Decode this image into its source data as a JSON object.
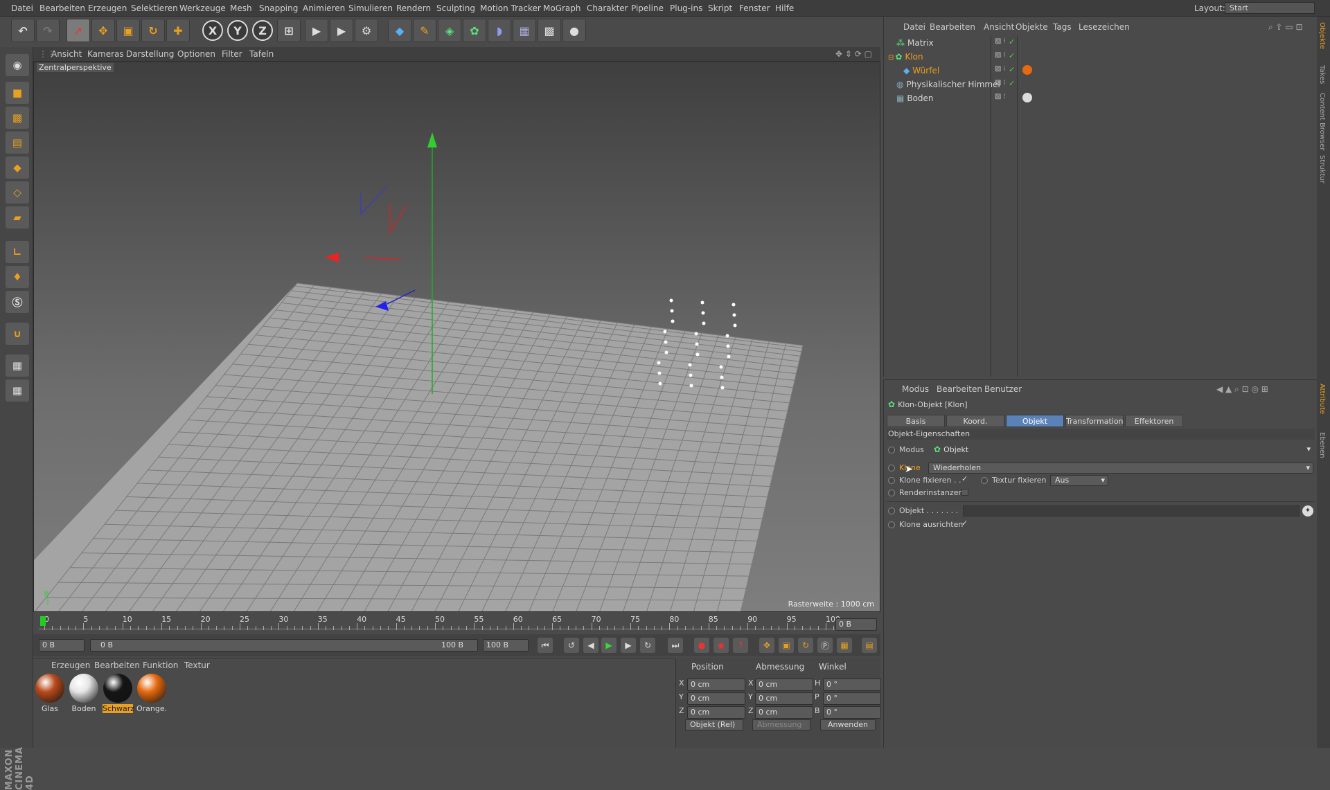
{
  "menubar": {
    "items": [
      "Datei",
      "Bearbeiten",
      "Erzeugen",
      "Selektieren",
      "Werkzeuge",
      "Mesh",
      "Snapping",
      "Animieren",
      "Simulieren",
      "Rendern",
      "Sculpting",
      "Motion Tracker",
      "MoGraph",
      "Charakter",
      "Pipeline",
      "Plug-ins",
      "Skript",
      "Fenster",
      "Hilfe"
    ],
    "layout_label": "Layout:",
    "layout_value": "Start"
  },
  "toolbar": {
    "axis_x": "X",
    "axis_y": "Y",
    "axis_z": "Z"
  },
  "viewport": {
    "menu": [
      "Ansicht",
      "Kameras",
      "Darstellung",
      "Optionen",
      "Filter",
      "Tafeln"
    ],
    "camera_label": "Zentralperspektive",
    "grid_size": "Rasterweite : 1000 cm"
  },
  "timeline": {
    "ticks": [
      "0",
      "5",
      "10",
      "15",
      "20",
      "25",
      "30",
      "35",
      "40",
      "45",
      "50",
      "55",
      "60",
      "65",
      "70",
      "75",
      "80",
      "85",
      "90",
      "95",
      "100"
    ],
    "current_frame": "0 B",
    "start_field": "0 B",
    "range_start": "0 B",
    "range_end": "100 B",
    "end_field": "100 B"
  },
  "materials": {
    "menu": [
      "Erzeugen",
      "Bearbeiten",
      "Funktion",
      "Textur"
    ],
    "items": [
      {
        "name": "Glas",
        "color": "#b84a1c"
      },
      {
        "name": "Boden",
        "color": "#e6e6e6"
      },
      {
        "name": "Schwarz",
        "color": "#151515",
        "selected": true
      },
      {
        "name": "Orange.",
        "color": "#e66a10"
      }
    ]
  },
  "coords": {
    "headers": [
      "Position",
      "Abmessung",
      "Winkel"
    ],
    "rows": [
      {
        "axis": "X",
        "pos": "0 cm",
        "axis2": "X",
        "size": "0 cm",
        "rot_axis": "H",
        "rot": "0 °"
      },
      {
        "axis": "Y",
        "pos": "0 cm",
        "axis2": "Y",
        "size": "0 cm",
        "rot_axis": "P",
        "rot": "0 °"
      },
      {
        "axis": "Z",
        "pos": "0 cm",
        "axis2": "Z",
        "size": "0 cm",
        "rot_axis": "B",
        "rot": "0 °"
      }
    ],
    "mode": "Objekt (Rel)",
    "mode2": "Abmessung",
    "apply": "Anwenden"
  },
  "objects": {
    "menu": [
      "Datei",
      "Bearbeiten",
      "Ansicht",
      "Objekte",
      "Tags",
      "Lesezeichen"
    ],
    "items": [
      {
        "name": "Matrix"
      },
      {
        "name": "Klon"
      },
      {
        "name": "Würfel"
      },
      {
        "name": "Physikalischer Himmel"
      },
      {
        "name": "Boden"
      }
    ]
  },
  "attributes": {
    "menu": [
      "Modus",
      "Bearbeiten",
      "Benutzer"
    ],
    "title": "Klon-Objekt [Klon]",
    "tabs": [
      "Basis",
      "Koord.",
      "Objekt",
      "Transformation",
      "Effektoren"
    ],
    "section": "Objekt-Eigenschaften",
    "props": {
      "modus_label": "Modus",
      "modus_value": "Objekt",
      "klone_label": "Klone",
      "klone_value": "Wiederholen",
      "fix_label": "Klone fixieren . .",
      "fix_check": "✓",
      "texfix_label": "Textur fixieren",
      "texfix_value": "Aus",
      "render_label": "Renderinstanzen",
      "obj_label": "Objekt . . . . . . .",
      "align_label": "Klone ausrichten",
      "align_check": "✓"
    }
  },
  "side_tabs": [
    "Objekte",
    "Takes",
    "Content Browser",
    "Struktur",
    "Attribute",
    "Ebenen"
  ],
  "brand": "MAXON CINEMA 4D"
}
